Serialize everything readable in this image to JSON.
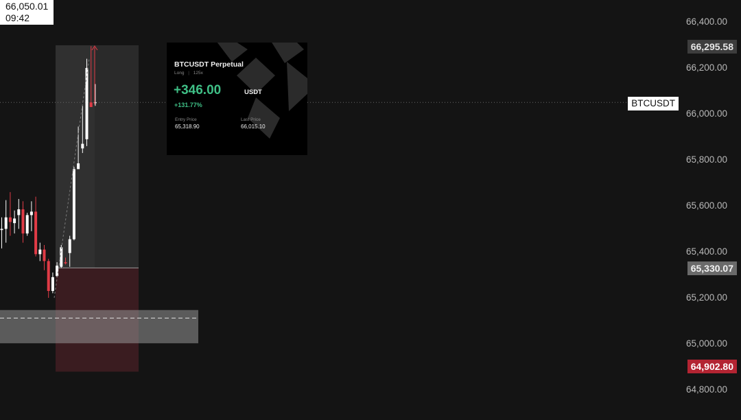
{
  "chart_data": {
    "type": "candlestick",
    "symbol": "BTCUSDT",
    "y_ticks": [
      66400,
      66200,
      66000,
      65800,
      65600,
      65400,
      65200,
      65000,
      64800
    ],
    "y_tick_labels": [
      "66,400.00",
      "66,200.00",
      "66,000.00",
      "65,800.00",
      "65,600.00",
      "65,400.00",
      "65,200.00",
      "65,000.00",
      "64,800.00"
    ],
    "candles": [
      {
        "o": 65495,
        "h": 65550,
        "l": 65415,
        "c": 65500
      },
      {
        "o": 65500,
        "h": 65625,
        "l": 65440,
        "c": 65550
      },
      {
        "o": 65550,
        "h": 65660,
        "l": 65470,
        "c": 65530
      },
      {
        "o": 65525,
        "h": 65580,
        "l": 65480,
        "c": 65545
      },
      {
        "o": 65560,
        "h": 65630,
        "l": 65500,
        "c": 65585
      },
      {
        "o": 65585,
        "h": 65620,
        "l": 65440,
        "c": 65480
      },
      {
        "o": 65480,
        "h": 65570,
        "l": 65470,
        "c": 65560
      },
      {
        "o": 65560,
        "h": 65620,
        "l": 65490,
        "c": 65575
      },
      {
        "o": 65575,
        "h": 65640,
        "l": 65380,
        "c": 65390
      },
      {
        "o": 65390,
        "h": 65440,
        "l": 65360,
        "c": 65410
      },
      {
        "o": 65410,
        "h": 65430,
        "l": 65320,
        "c": 65360
      },
      {
        "o": 65360,
        "h": 65370,
        "l": 65200,
        "c": 65230
      },
      {
        "o": 65230,
        "h": 65310,
        "l": 65220,
        "c": 65290
      },
      {
        "o": 65295,
        "h": 65355,
        "l": 65290,
        "c": 65340
      },
      {
        "o": 65335,
        "h": 65430,
        "l": 65330,
        "c": 65420
      },
      {
        "o": 65355,
        "h": 65375,
        "l": 65345,
        "c": 65350
      },
      {
        "o": 65395,
        "h": 65470,
        "l": 65335,
        "c": 65455
      },
      {
        "o": 65455,
        "h": 65770,
        "l": 65450,
        "c": 65760
      },
      {
        "o": 65760,
        "h": 65945,
        "l": 65770,
        "c": 65785
      },
      {
        "o": 65850,
        "h": 66035,
        "l": 65830,
        "c": 65870
      },
      {
        "o": 65890,
        "h": 66240,
        "l": 65860,
        "c": 66200
      },
      {
        "o": 66050,
        "h": 66295,
        "l": 66030,
        "c": 66030
      },
      {
        "o": 66050,
        "h": 66130,
        "l": 66035,
        "c": 66050
      }
    ],
    "position": {
      "entry": 65330.07,
      "target": 66295.58,
      "stop": 64902.8,
      "last": 66050.01
    },
    "liquidity_band": {
      "top": 65147,
      "bottom": 65077,
      "mid": 65112
    }
  },
  "axis": {
    "tag_top": "66,295.58",
    "tag_entry": "65,330.07",
    "tag_stop": "64,902.80",
    "tag_last_price": "66,050.01",
    "tag_last_time": "09:42",
    "symbol_tag": "BTCUSDT"
  },
  "card": {
    "title": "BTCUSDT Perpetual",
    "side": "Long",
    "leverage": "125x",
    "pnl": "+346.00",
    "pnl_unit": "USDT",
    "pnl_pct": "+131.77%",
    "entry_label": "Entry Price",
    "entry_value": "65,318.90",
    "last_label": "Last Price",
    "last_value": "66,015.10"
  },
  "colors": {
    "background": "#141414",
    "bull": "#ffffff",
    "bear": "#e03b46",
    "profit_green": "#3fbf86",
    "stop_zone": "#3a1c20",
    "target_zone": "#2a2a2a"
  }
}
